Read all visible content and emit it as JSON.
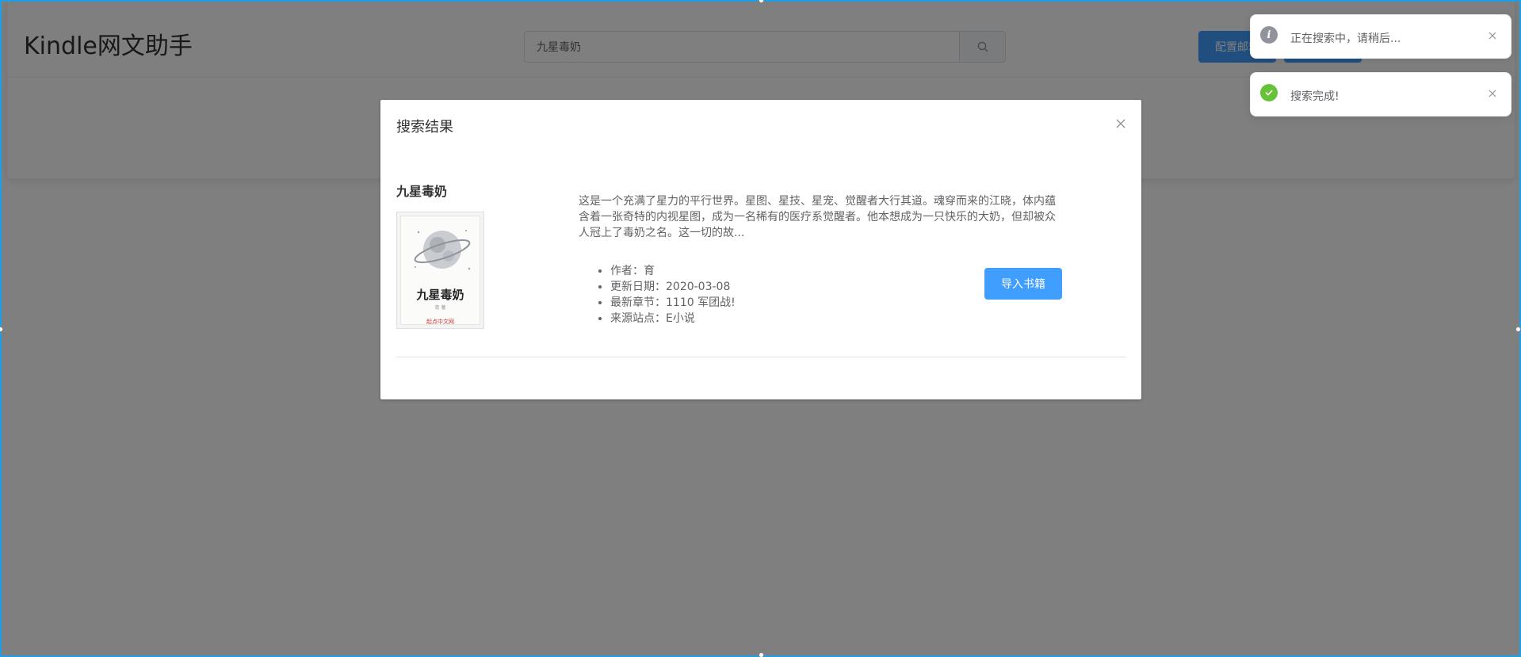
{
  "header": {
    "app_title": "Kindle网文助手",
    "search_value": "九星毒奶",
    "search_icon": "search-icon",
    "config_button_label": "配置邮箱",
    "second_button_label": ""
  },
  "dialog": {
    "title": "搜索结果",
    "close_icon": "close-icon",
    "book": {
      "title": "九星毒奶",
      "cover_title": "九星毒奶",
      "cover_sub": "育 著",
      "cover_logo": "起点中文网",
      "description": "这是一个充满了星力的平行世界。星图、星技、星宠、觉醒者大行其道。魂穿而来的江晓，体内蕴含着一张奇特的内视星图，成为一名稀有的医疗系觉醒者。他本想成为一只快乐的大奶，但却被众人冠上了毒奶之名。这一切的故...",
      "meta": [
        "作者：育",
        "更新日期：2020-03-08",
        "最新章节：1110 军团战!",
        "来源站点：E小说"
      ],
      "import_button_label": "导入书籍"
    }
  },
  "notifications": [
    {
      "type": "info",
      "icon": "info-icon",
      "text": "正在搜索中，请稍后..."
    },
    {
      "type": "success",
      "icon": "check-icon",
      "text": "搜索完成!"
    }
  ],
  "colors": {
    "primary": "#409eff",
    "success": "#67c23a",
    "info": "#909399",
    "selection": "#1e9ee8"
  }
}
